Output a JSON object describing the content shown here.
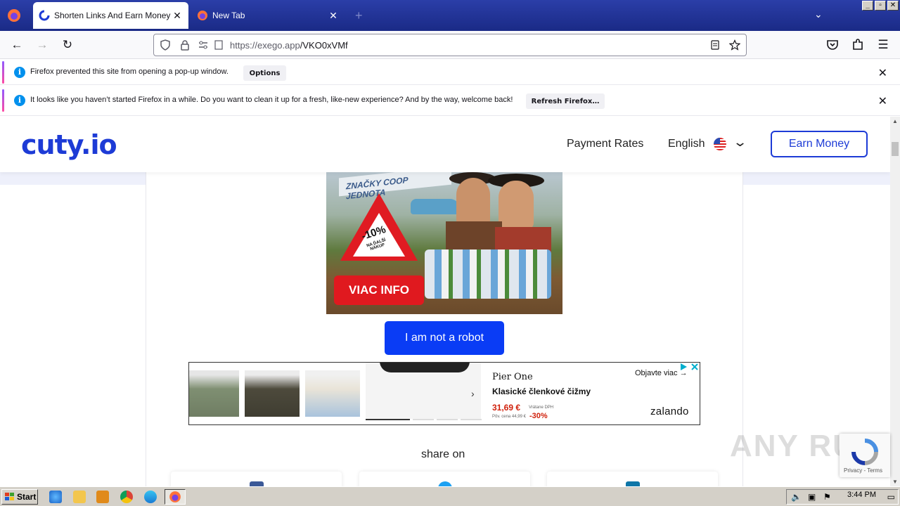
{
  "browser": {
    "tabs": [
      {
        "label": "Shorten Links And Earn Money | cu",
        "active": true
      },
      {
        "label": "New Tab",
        "active": false
      }
    ],
    "url_host": "https://exego.app",
    "url_path": "/VKO0xVMf"
  },
  "notifications": [
    {
      "message": "Firefox prevented this site from opening a pop-up window.",
      "button": "Options"
    },
    {
      "message": "It looks like you haven’t started Firefox in a while. Do you want to clean it up for a fresh, like-new experience? And by the way, welcome back!",
      "button": "Refresh Firefox…"
    }
  ],
  "site": {
    "logo": "cuty.io",
    "nav": {
      "payment_rates": "Payment Rates",
      "language": "English",
      "earn_money": "Earn Money"
    },
    "ad1": {
      "headline": "ZNAČKY COOP JEDNOTA",
      "discount": "-10%",
      "discount_sub": "NA ĎALŠÍ NÁKUP",
      "cta": "VIAC INFO"
    },
    "robot_button": "I am not a robot",
    "ad2": {
      "brand": "Pier One",
      "product": "Klasické členkové čižmy",
      "price": "31,69 €",
      "old_price": "Vrátane DPH",
      "old_price2": "Pôv. cena 44,99 €",
      "discount": "-30%",
      "cta": "Objavte viac",
      "store": "zalando"
    },
    "share_label": "share on"
  },
  "recaptcha": {
    "links": "Privacy - Terms"
  },
  "watermark": "ANY RUN",
  "taskbar": {
    "start": "Start",
    "clock": "3:44 PM"
  },
  "colors": {
    "brand_blue": "#1d3bd6",
    "robot_button": "#0a3cf5",
    "ad_red": "#e0191f"
  }
}
